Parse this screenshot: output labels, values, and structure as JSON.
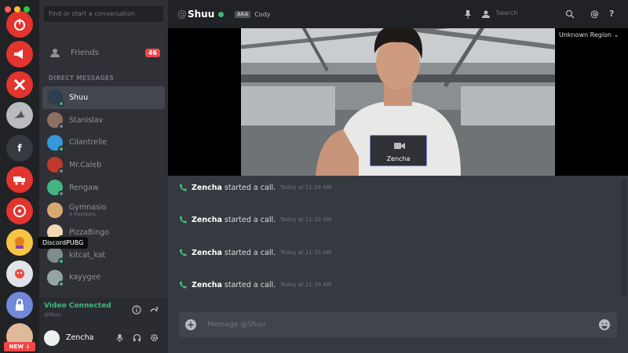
{
  "search": {
    "placeholder": "Find or start a conversation"
  },
  "friends": {
    "label": "Friends",
    "badge": "46"
  },
  "direct_messages_header": "DIRECT MESSAGES",
  "dms": [
    {
      "name": "Shuu",
      "status": "online",
      "active": true,
      "sub": ""
    },
    {
      "name": "Stanislav",
      "status": "offline",
      "sub": ""
    },
    {
      "name": "Cilantrelle",
      "status": "online",
      "sub": ""
    },
    {
      "name": "Mr.Caleb",
      "status": "offline",
      "sub": ""
    },
    {
      "name": "Rengaw",
      "status": "offline",
      "sub": ""
    },
    {
      "name": "Gymnasio",
      "status": "offline",
      "sub": "4 Members"
    },
    {
      "name": "PizzaBingo",
      "status": "offline",
      "sub": ""
    },
    {
      "name": "kitcat_kat",
      "status": "online",
      "sub": ""
    },
    {
      "name": "kayygee",
      "status": "online",
      "sub": ""
    }
  ],
  "guild_tooltip": "DiscordPUBG",
  "guild_new_badge": "NEW",
  "guild_text_icon": "f",
  "voice": {
    "status": "Video Connected",
    "channel": "@Shuu"
  },
  "user": {
    "name": "Zencha"
  },
  "channel": {
    "at": "@",
    "name": "Shuu",
    "aka_label": "AKA",
    "aka_name": "Cody"
  },
  "toolbar": {
    "search_placeholder": "Search",
    "help": "?",
    "mention": "@"
  },
  "call": {
    "region": "Unknown Region",
    "pip_name": "Zencha"
  },
  "messages": [
    {
      "user": "Zencha",
      "text": "started a call.",
      "time": "Today at 11:28 AM"
    },
    {
      "user": "Zencha",
      "text": "started a call.",
      "time": "Today at 11:33 AM"
    },
    {
      "user": "Zencha",
      "text": "started a call.",
      "time": "Today at 11:35 AM"
    },
    {
      "user": "Zencha",
      "text": "started a call.",
      "time": "Today at 11:39 AM"
    }
  ],
  "composer": {
    "placeholder": "Message @Shuu"
  },
  "colors": {
    "online": "#43b581",
    "danger": "#f04747",
    "blurple": "#7289da",
    "bg_dark": "#202225",
    "bg_channels": "#2f3136",
    "bg_main": "#36393f"
  }
}
